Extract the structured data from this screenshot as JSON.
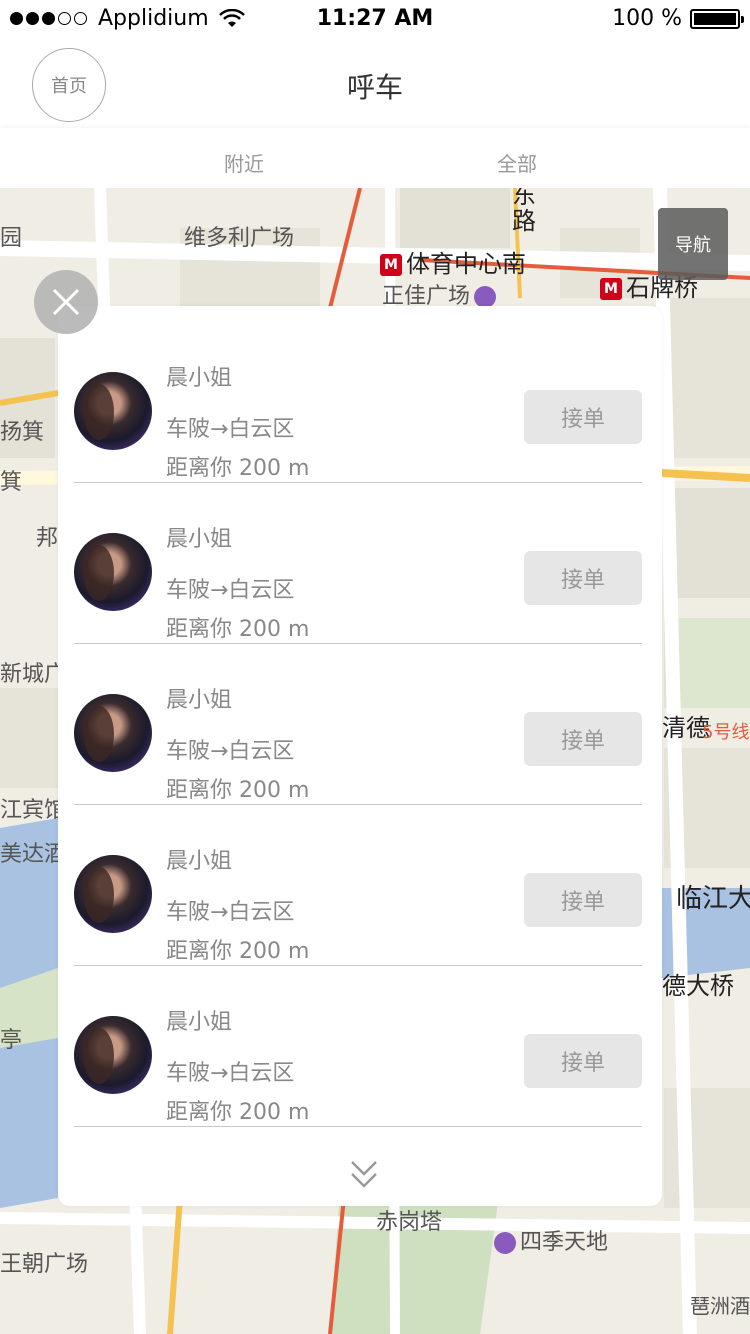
{
  "status_bar": {
    "carrier": "Applidium",
    "time": "11:27 AM",
    "battery": "100 %"
  },
  "nav": {
    "home_label": "首页",
    "title": "呼车"
  },
  "tabs": [
    {
      "label": "附近"
    },
    {
      "label": "全部"
    }
  ],
  "map": {
    "nav_button": "导航",
    "labels": {
      "park": "园",
      "victoria": "维多利广场",
      "road": "东路",
      "tiyu_metro": "体育中心南",
      "zhengjia": "正佳广场",
      "shipaiqiao": "石牌桥",
      "chuanbin1": "扬箕",
      "chuanbin2": "箕",
      "bang": "邦",
      "xincheng": "新城广",
      "qingde": "清德",
      "line5": "5号线",
      "jiang_hotel": "江宾馆",
      "meida": "美达酒",
      "linjiang": "临江大",
      "daqiao": "德大桥",
      "ting": "亭",
      "chigang": "赤岗塔",
      "siji": "四季天地",
      "chaoguang": "王朝广场",
      "pazhou": "琶洲酒"
    }
  },
  "orders": [
    {
      "name": "晨小姐",
      "route": "车陂→白云区",
      "distance": "距离你  200 m",
      "accept": "接单"
    },
    {
      "name": "晨小姐",
      "route": "车陂→白云区",
      "distance": "距离你  200 m",
      "accept": "接单"
    },
    {
      "name": "晨小姐",
      "route": "车陂→白云区",
      "distance": "距离你  200 m",
      "accept": "接单"
    },
    {
      "name": "晨小姐",
      "route": "车陂→白云区",
      "distance": "距离你  200 m",
      "accept": "接单"
    },
    {
      "name": "晨小姐",
      "route": "车陂→白云区",
      "distance": "距离你  200 m",
      "accept": "接单"
    }
  ]
}
